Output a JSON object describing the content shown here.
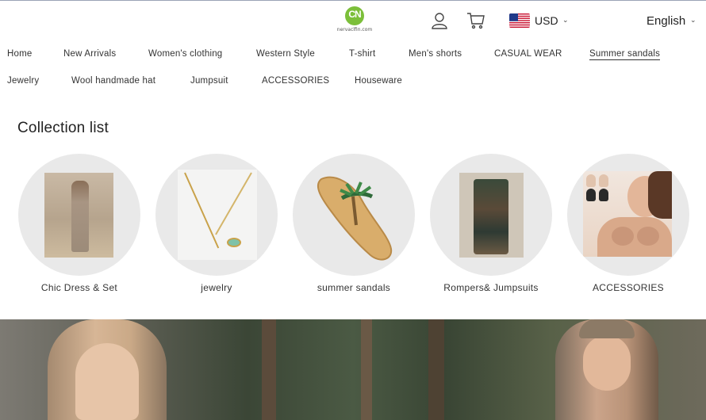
{
  "header": {
    "logo": {
      "mark": "CN",
      "text": "nervaclfin.com"
    },
    "currency": {
      "code": "USD",
      "flag": "us-flag-icon"
    },
    "language": "English"
  },
  "nav": {
    "row1": [
      {
        "label": "Home",
        "active": false
      },
      {
        "label": "New Arrivals",
        "active": false
      },
      {
        "label": "Women's clothing",
        "active": false
      },
      {
        "label": "Western Style",
        "active": false
      },
      {
        "label": "T-shirt",
        "active": false
      },
      {
        "label": "Men's shorts",
        "active": false
      },
      {
        "label": "CASUAL WEAR",
        "active": false
      },
      {
        "label": "Summer sandals",
        "active": true
      }
    ],
    "row2": [
      {
        "label": "Jewelry"
      },
      {
        "label": "Wool handmade hat"
      },
      {
        "label": "Jumpsuit"
      },
      {
        "label": "ACCESSORIES"
      },
      {
        "label": "Houseware"
      }
    ]
  },
  "collection": {
    "title": "Collection list",
    "items": [
      {
        "label": "Chic Dress & Set",
        "image": "dress-photo"
      },
      {
        "label": "jewelry",
        "image": "necklace-photo"
      },
      {
        "label": "summer sandals",
        "image": "sandal-photo"
      },
      {
        "label": "Rompers& Jumpsuits",
        "image": "jumpsuit-photo"
      },
      {
        "label": "ACCESSORIES",
        "image": "accessories-photo"
      }
    ]
  },
  "colors": {
    "accent_logo": "#7cbf3a",
    "circle_bg": "#e9e9e9",
    "text": "#333333"
  }
}
